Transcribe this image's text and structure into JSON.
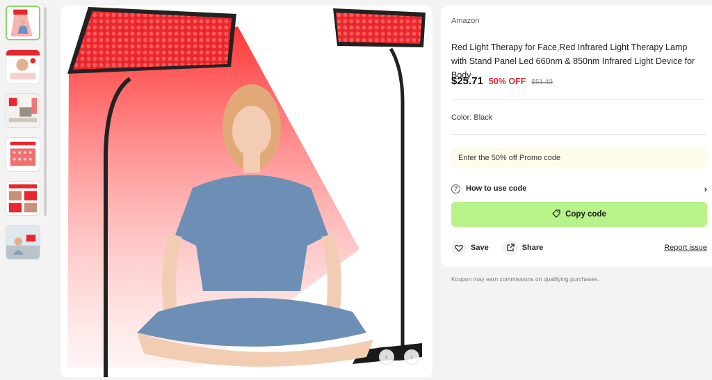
{
  "product": {
    "store": "Amazon",
    "title": "Red Light Therapy for Face,Red Infrared Light Therapy Lamp with Stand Panel Led 660nm & 850nm Infrared Light Device for Body",
    "price": "$25.71",
    "discount": "50% OFF",
    "original_price": "$51.43",
    "color": "Color: Black"
  },
  "promo": {
    "text": "Enter the 50% off Promo code",
    "how_to_label": "How to use code",
    "copy_label": "Copy code"
  },
  "actions": {
    "save": "Save",
    "share": "Share",
    "report": "Report issue"
  },
  "footer_note": "Koupon may earn commissions on qualifying purchases.",
  "colors": {
    "accent_green": "#b8f28a",
    "discount_red": "#e0282e",
    "panel_red": "#e8262c"
  },
  "thumbnails": [
    {
      "name": "thumbnail-1",
      "active": true
    },
    {
      "name": "thumbnail-2",
      "active": false
    },
    {
      "name": "thumbnail-3",
      "active": false
    },
    {
      "name": "thumbnail-4",
      "active": false
    },
    {
      "name": "thumbnail-5",
      "active": false
    },
    {
      "name": "thumbnail-6",
      "active": false
    }
  ]
}
